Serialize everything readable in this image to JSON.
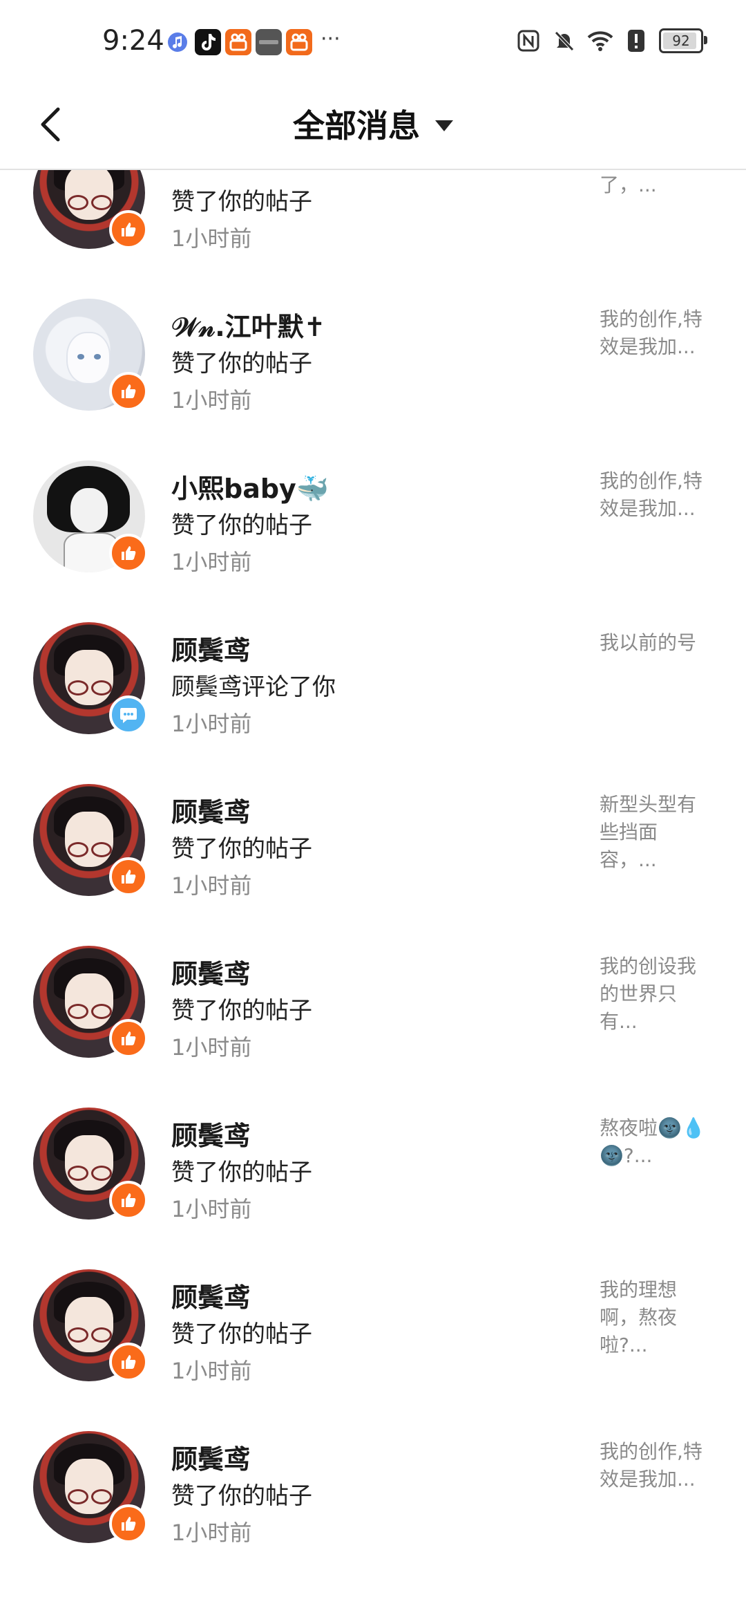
{
  "status_bar": {
    "time": "9:24",
    "battery": "92",
    "battery_level": 0.92,
    "more": "···"
  },
  "header": {
    "title": "全部消息"
  },
  "items": [
    {
      "name": "",
      "action": "赞了你的帖子",
      "time": "1小时前",
      "preview": "节拍开始了，...",
      "avatar": "dark",
      "badge": "like"
    },
    {
      "name": "𝒲𝓃.江叶默✝",
      "action": "赞了你的帖子",
      "time": "1小时前",
      "preview": "我的创作,特效是我加...",
      "avatar": "white",
      "badge": "like"
    },
    {
      "name": "小熙baby🐳",
      "action": "赞了你的帖子",
      "time": "1小时前",
      "preview": "我的创作,特效是我加...",
      "avatar": "bw",
      "badge": "like"
    },
    {
      "name": "顾鬓鸢",
      "action": "顾鬓鸢评论了你",
      "time": "1小时前",
      "preview": "我以前的号",
      "avatar": "dark",
      "badge": "comment"
    },
    {
      "name": "顾鬓鸢",
      "action": "赞了你的帖子",
      "time": "1小时前",
      "preview": "新型头型有些挡面容，...",
      "avatar": "dark",
      "badge": "like"
    },
    {
      "name": "顾鬓鸢",
      "action": "赞了你的帖子",
      "time": "1小时前",
      "preview": "我的创设我的世界只有...",
      "avatar": "dark",
      "badge": "like"
    },
    {
      "name": "顾鬓鸢",
      "action": "赞了你的帖子",
      "time": "1小时前",
      "preview": "熬夜啦🌚💧🌚?...",
      "avatar": "dark",
      "badge": "like"
    },
    {
      "name": "顾鬓鸢",
      "action": "赞了你的帖子",
      "time": "1小时前",
      "preview": "我的理想啊，熬夜啦?...",
      "avatar": "dark",
      "badge": "like"
    },
    {
      "name": "顾鬓鸢",
      "action": "赞了你的帖子",
      "time": "1小时前",
      "preview": "我的创作,特效是我加...",
      "avatar": "dark",
      "badge": "like"
    }
  ]
}
